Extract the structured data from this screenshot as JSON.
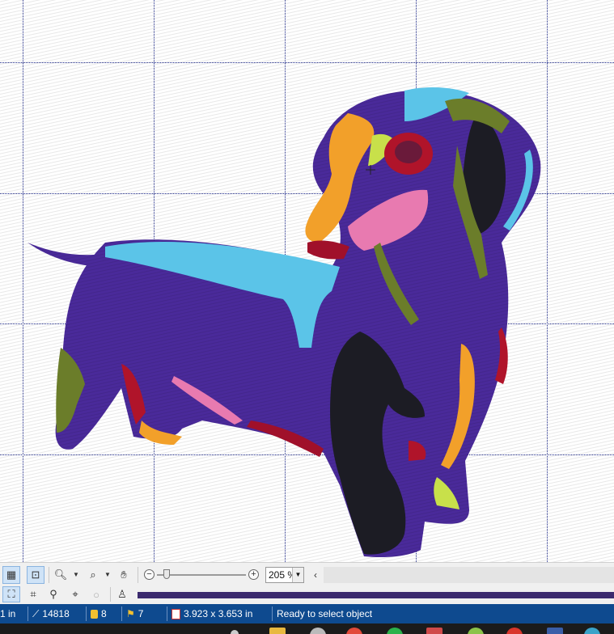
{
  "canvas": {
    "description_icon": "embroidery-design-dachshund"
  },
  "toolbar": {
    "zoom_value": "205 %",
    "zoom_level": 205
  },
  "status": {
    "position": "1 in",
    "stitches": "14818",
    "colors": "8",
    "color_changes": "7",
    "size": "3.923 x 3.653 in",
    "message": "Ready to select object"
  },
  "colors": {
    "status_bar": "#0e4a8f",
    "grid_line": "#1e2a8c",
    "dog_body": "#4a2a9a"
  }
}
